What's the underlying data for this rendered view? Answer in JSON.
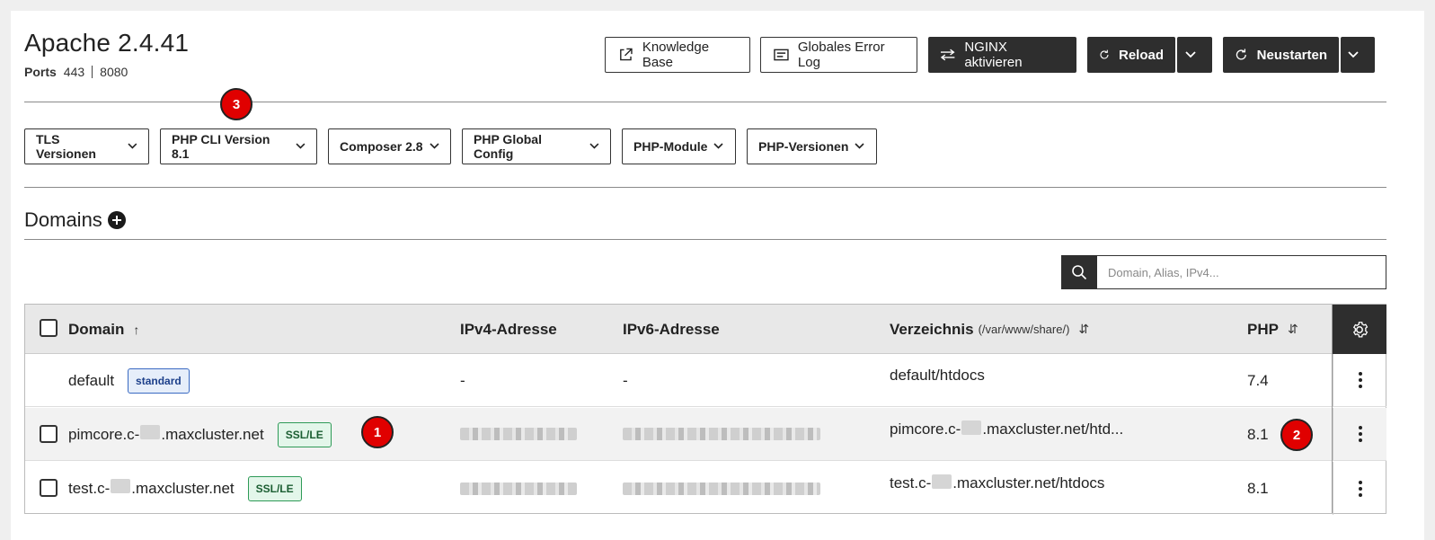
{
  "header": {
    "title": "Apache 2.4.41",
    "ports_label": "Ports",
    "ports": [
      "443",
      "8080"
    ]
  },
  "actions": {
    "knowledge_base": "Knowledge Base",
    "error_log": "Globales Error Log",
    "nginx": "NGINX aktivieren",
    "reload": "Reload",
    "restart": "Neustarten"
  },
  "dropdowns": [
    "TLS Versionen",
    "PHP CLI Version 8.1",
    "Composer 2.8",
    "PHP Global Config",
    "PHP-Module",
    "PHP-Versionen"
  ],
  "domains_section": {
    "title": "Domains"
  },
  "search": {
    "placeholder": "Domain, Alias, IPv4..."
  },
  "table": {
    "headers": {
      "domain": "Domain",
      "ipv4": "IPv4-Adresse",
      "ipv6": "IPv6-Adresse",
      "directory": "Verzeichnis",
      "directory_hint": "(/var/www/share/)",
      "php": "PHP"
    },
    "rows": [
      {
        "domain": "default",
        "badge": "standard",
        "ipv4": "-",
        "ipv6": "-",
        "directory": "default/htdocs",
        "php": "7.4"
      },
      {
        "domain_prefix": "pimcore.c-",
        "domain_suffix": ".maxcluster.net",
        "badge": "SSL/LE",
        "directory_prefix": "pimcore.c-",
        "directory_suffix": ".maxcluster.net/htd...",
        "php": "8.1"
      },
      {
        "domain_prefix": "test.c-",
        "domain_suffix": ".maxcluster.net",
        "badge": "SSL/LE",
        "directory_prefix": "test.c-",
        "directory_suffix": ".maxcluster.net/htdocs",
        "php": "8.1"
      }
    ]
  },
  "annotations": [
    "1",
    "2",
    "3"
  ],
  "colors": {
    "dark_button": "#2e2e2e",
    "marker": "#e00000",
    "badge_blue": "#3a6ac2",
    "badge_green": "#2e9a57"
  }
}
